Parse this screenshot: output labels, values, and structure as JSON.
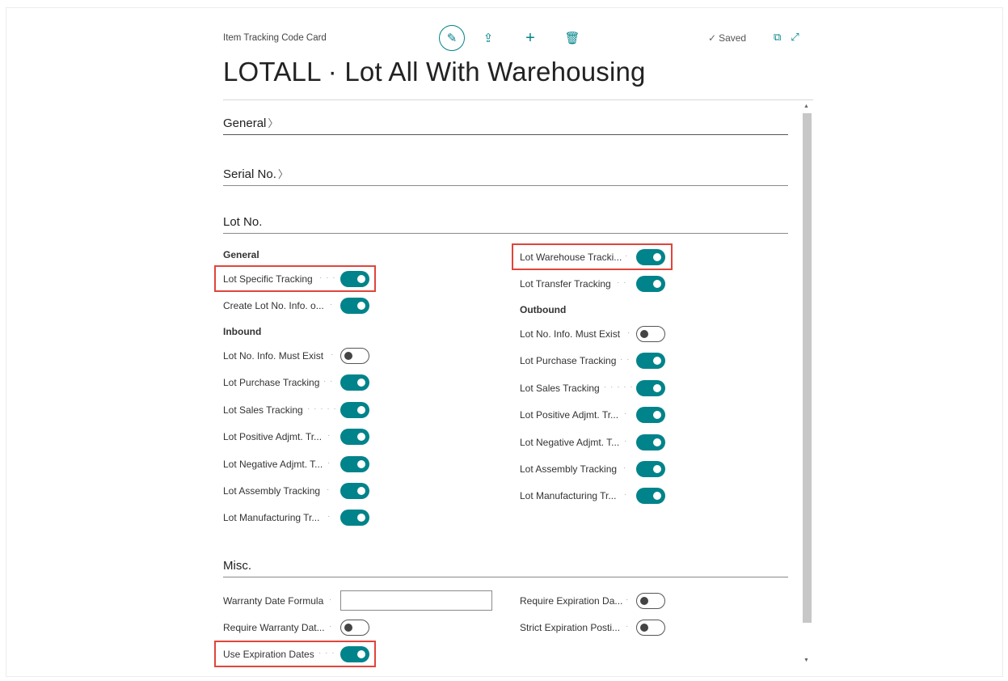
{
  "header": {
    "caption": "Item Tracking Code Card",
    "title": "LOTALL · Lot All With Warehousing",
    "saved_label": "Saved"
  },
  "sections": {
    "general": "General",
    "serial": "Serial No.",
    "lot": "Lot No.",
    "misc": "Misc."
  },
  "lot": {
    "left_groups": {
      "general": "General",
      "inbound": "Inbound"
    },
    "right_groups": {
      "outbound": "Outbound"
    },
    "general_fields": [
      {
        "label": "Lot Specific Tracking",
        "on": true
      },
      {
        "label": "Create Lot No. Info. o...",
        "on": true
      }
    ],
    "inbound_fields": [
      {
        "label": "Lot No. Info. Must Exist",
        "on": false
      },
      {
        "label": "Lot Purchase Tracking",
        "on": true
      },
      {
        "label": "Lot Sales Tracking",
        "on": true
      },
      {
        "label": "Lot Positive Adjmt. Tr...",
        "on": true
      },
      {
        "label": "Lot Negative Adjmt. T...",
        "on": true
      },
      {
        "label": "Lot Assembly Tracking",
        "on": true
      },
      {
        "label": "Lot Manufacturing Tr...",
        "on": true
      }
    ],
    "right_top_fields": [
      {
        "label": "Lot Warehouse Tracki...",
        "on": true
      },
      {
        "label": "Lot Transfer Tracking",
        "on": true
      }
    ],
    "outbound_fields": [
      {
        "label": "Lot No. Info. Must Exist",
        "on": false
      },
      {
        "label": "Lot Purchase Tracking",
        "on": true
      },
      {
        "label": "Lot Sales Tracking",
        "on": true
      },
      {
        "label": "Lot Positive Adjmt. Tr...",
        "on": true
      },
      {
        "label": "Lot Negative Adjmt. T...",
        "on": true
      },
      {
        "label": "Lot Assembly Tracking",
        "on": true
      },
      {
        "label": "Lot Manufacturing Tr...",
        "on": true
      }
    ]
  },
  "misc": {
    "warranty_formula_label": "Warranty Date Formula",
    "warranty_formula_value": "",
    "require_warranty_label": "Require Warranty Dat...",
    "require_warranty_on": false,
    "use_expiration_label": "Use Expiration Dates",
    "use_expiration_on": true,
    "require_expiration_label": "Require Expiration Da...",
    "require_expiration_on": false,
    "strict_expiration_label": "Strict Expiration Posti...",
    "strict_expiration_on": false
  },
  "colors": {
    "accent": "#00838a",
    "highlight": "#e0453b"
  },
  "icons": [
    "edit-icon",
    "share-icon",
    "add-icon",
    "delete-icon",
    "checkmark-icon",
    "open-in-new-window-icon",
    "expand-icon"
  ]
}
